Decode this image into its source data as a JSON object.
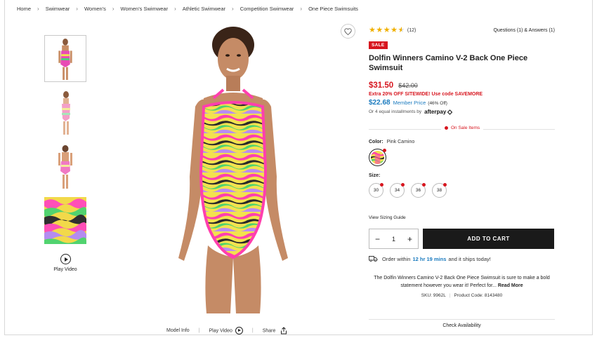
{
  "breadcrumb": [
    "Home",
    "Swimwear",
    "Women's",
    "Women's Swimwear",
    "Athletic Swimwear",
    "Competition Swimwear",
    "One Piece Swimsuits"
  ],
  "thumbnails": [
    "front-view-thumb",
    "side-view-thumb",
    "back-view-thumb",
    "print-detail-thumb"
  ],
  "media": {
    "play_video_label": "Play Video",
    "model_info_label": "Model Info",
    "play_video_bottom_label": "Play Video",
    "share_label": "Share"
  },
  "product": {
    "rating_value": 4.5,
    "review_count": "(12)",
    "qa_label": "Questions (1) & Answers (1)",
    "sale_badge": "SALE",
    "brand": "Dolfin",
    "name": "Winners Camino V-2 Back One Piece Swimsuit",
    "sale_price": "$31.50",
    "original_price": "$42.00",
    "promo": "Extra 20% OFF SITEWIDE! Use code SAVEMORE",
    "member_price": "$22.68",
    "member_label": "Member Price",
    "member_off": "(46% Off)",
    "afterpay_text": "Or 4 equal installments by",
    "afterpay_brand": "afterpay",
    "on_sale_label": "On Sale Items",
    "color_label": "Color:",
    "color_value": "Pink Camino",
    "size_label": "Size:",
    "sizes": [
      "30",
      "34",
      "36",
      "38"
    ],
    "sizing_guide": "View Sizing Guide",
    "quantity": "1",
    "add_to_cart": "ADD TO CART",
    "ship_prefix": "Order within",
    "ship_time": "12 hr 19 mins",
    "ship_suffix": "and it ships today!",
    "description": "The Dolfin Winners Camino V-2 Back One Piece Swimsuit is sure to make a bold statement however you wear it! Perfect for...",
    "read_more": "Read More",
    "sku": "SKU: 9962L",
    "product_code": "Product Code: 8143480",
    "check_availability": "Check Availability"
  },
  "colors": {
    "sale_red": "#d7161f",
    "member_blue": "#1b7bbf",
    "star_gold": "#f0b000",
    "cart_black": "#1a1a1a"
  }
}
